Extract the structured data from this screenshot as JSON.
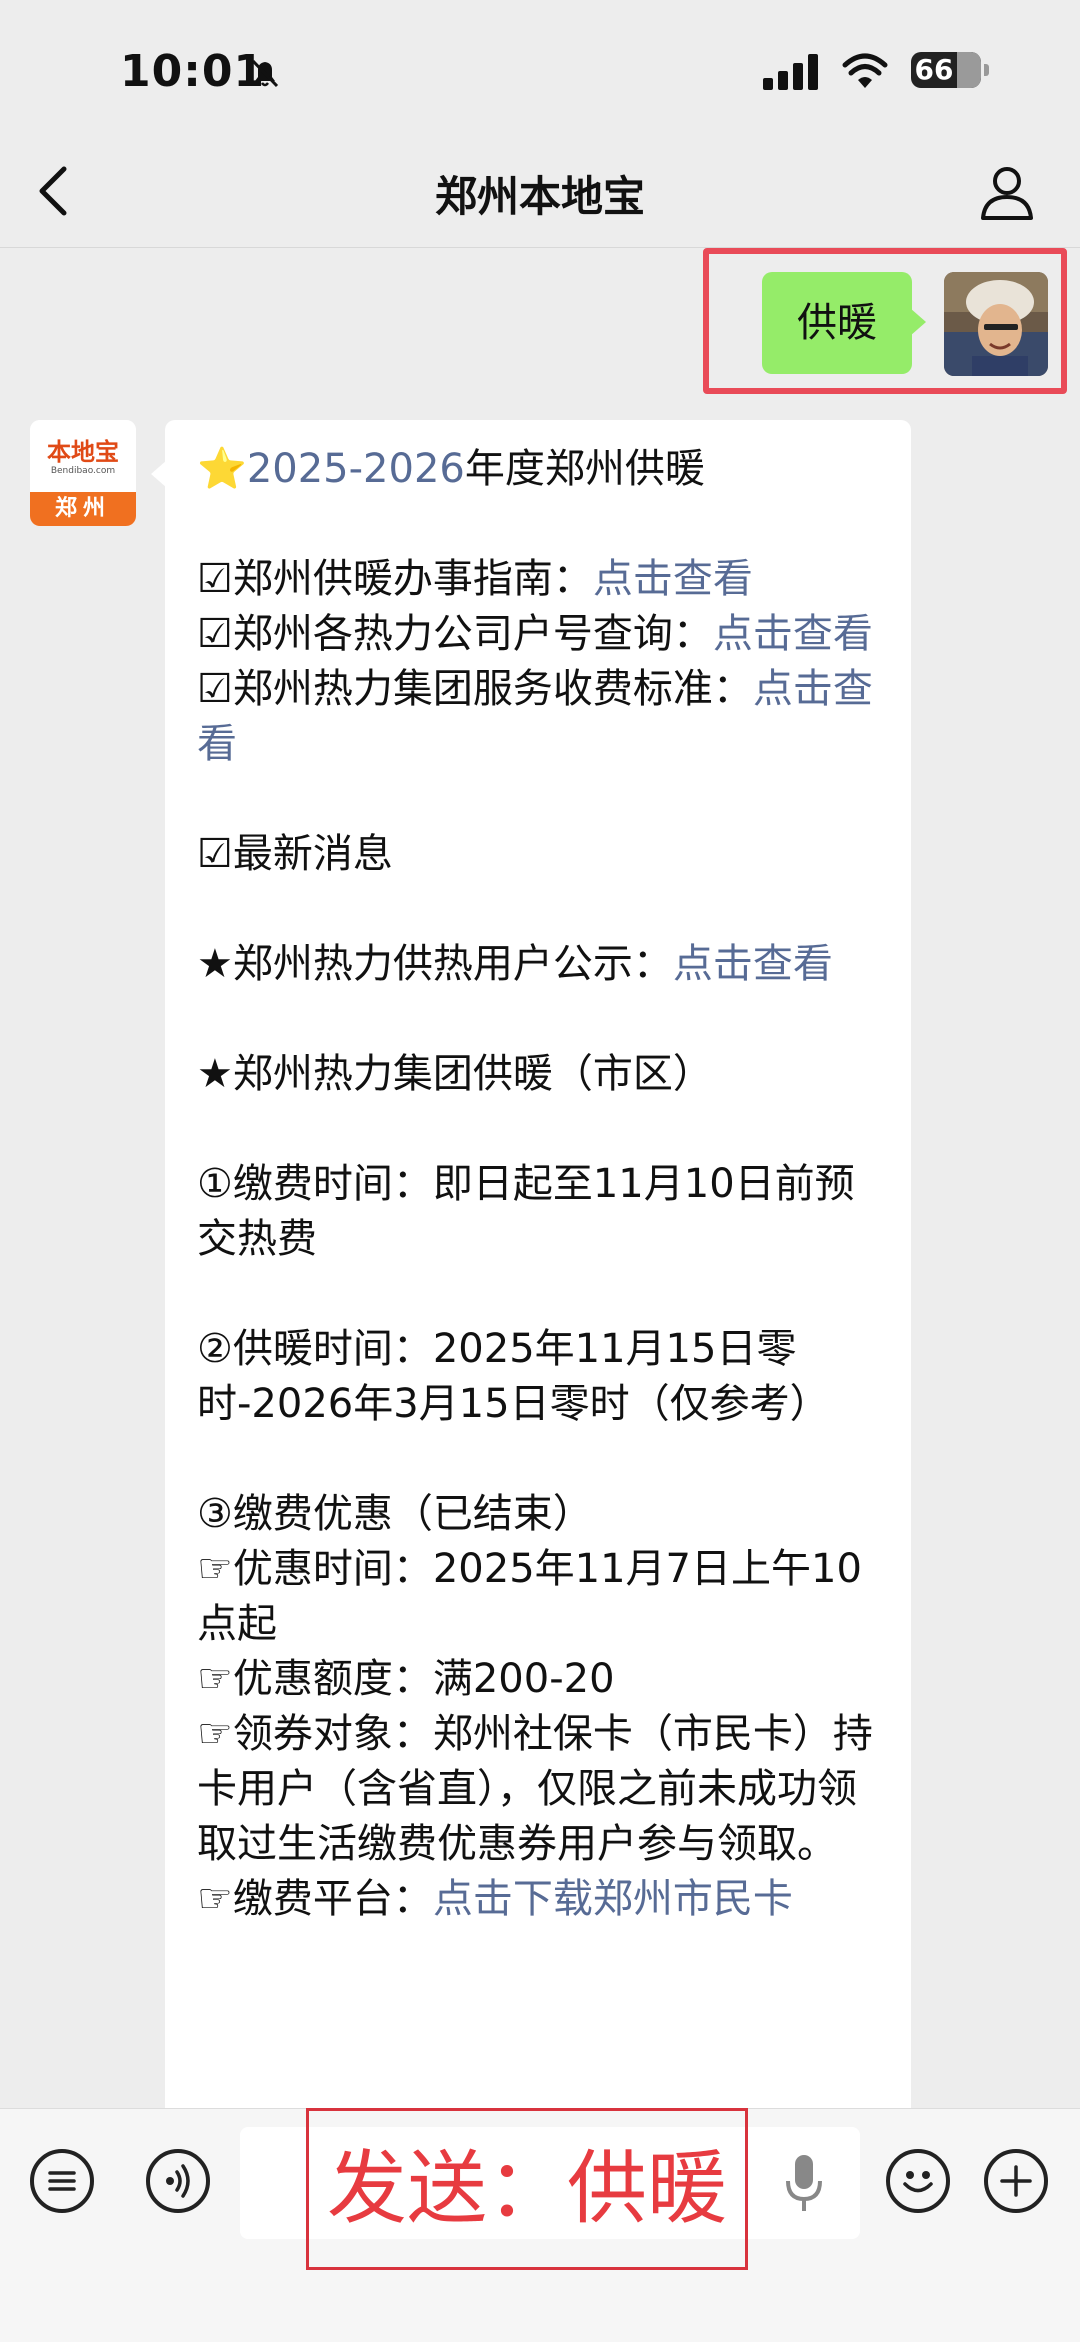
{
  "status_bar": {
    "time": "10:01",
    "battery": "66"
  },
  "nav": {
    "title": "郑州本地宝"
  },
  "sent_message": {
    "text": "供暖"
  },
  "bot": {
    "avatar_brand": "本地宝",
    "avatar_site": "Bendibao.com",
    "avatar_city": "郑州"
  },
  "reply": {
    "heading_year": "2025-2026",
    "heading_rest": "年度郑州供暖",
    "l1": "☑郑州供暖办事指南：",
    "l1_link": "点击查看",
    "l2": "☑郑州各热力公司户号查询：",
    "l2_link": "点击查看",
    "l3": "☑郑州热力集团服务收费标准：",
    "l3_link": "点击查看",
    "l4": "☑最新消息",
    "l5": "★郑州热力供热用户公示：",
    "l5_link": "点击查看",
    "l6": "★郑州热力集团供暖（市区）",
    "l7": "①缴费时间：即日起至11月10日前预交热费",
    "l8": "②供暖时间：2025年11月15日零时-2026年3月15日零时（仅参考）",
    "l9": "③缴费优惠（已结束）",
    "l10": "☞优惠时间：2025年11月7日上午10点起",
    "l11": "☞优惠额度：满200-20",
    "l12": "☞领券对象：郑州社保卡（市民卡）持卡用户（含省直），仅限之前未成功领取过生活缴费优惠券用户参与领取。",
    "l13": "☞缴费平台：",
    "l13_link": "点击下载郑州市民卡"
  },
  "annotation": {
    "send_label": "发送：供暖"
  }
}
